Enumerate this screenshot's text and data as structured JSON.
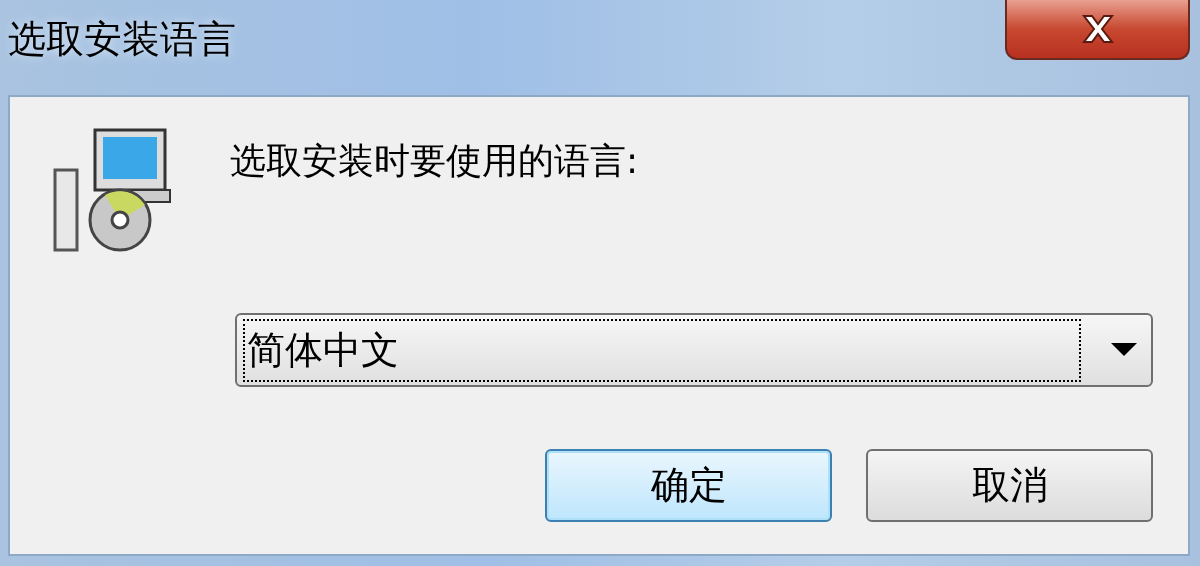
{
  "window": {
    "title": "选取安装语言"
  },
  "prompt": "选取安装时要使用的语言:",
  "language_select": {
    "value": "简体中文",
    "focused": true
  },
  "buttons": [
    {
      "label": "确定",
      "default": true
    },
    {
      "label": "取消",
      "default": false
    }
  ]
}
